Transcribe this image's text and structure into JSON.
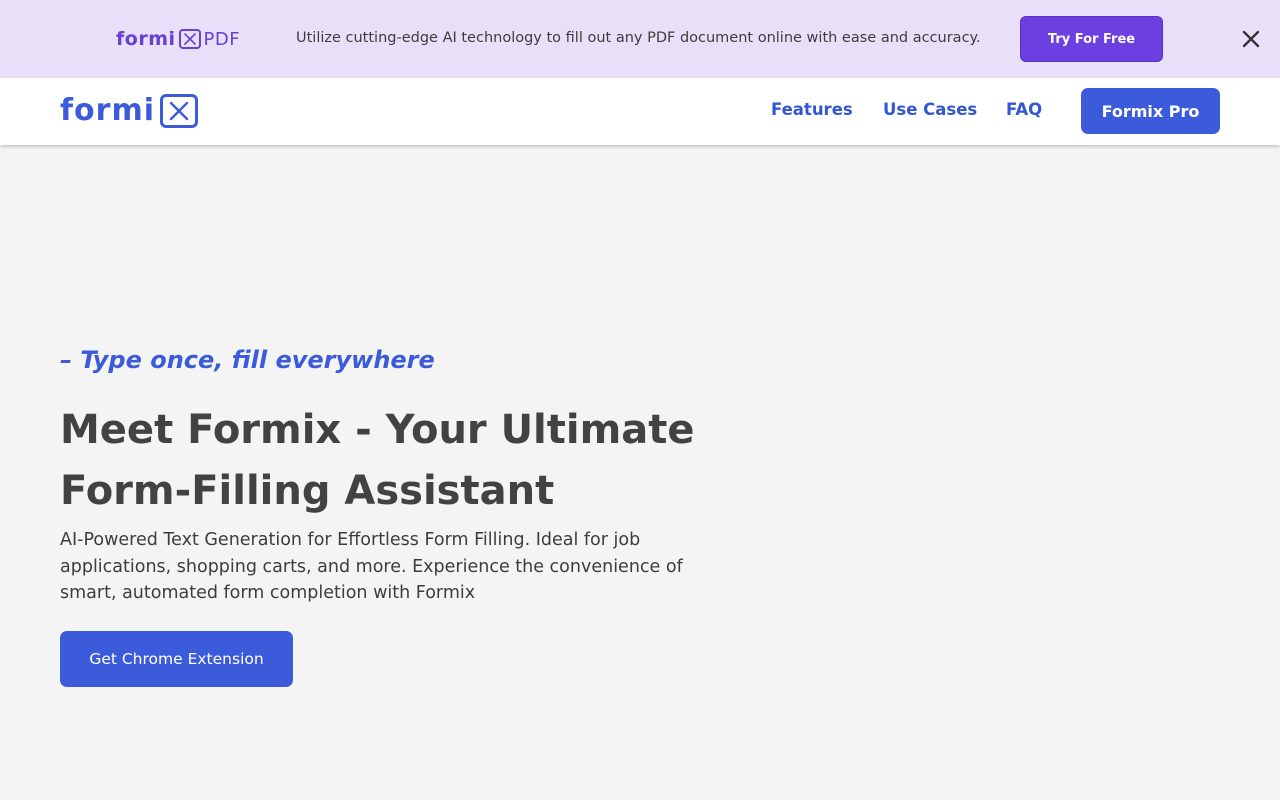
{
  "promo": {
    "brand_wordmark": "formi",
    "brand_suffix": "PDF",
    "message": "Utilize cutting-edge AI technology to fill out any PDF document online with ease and accuracy.",
    "cta_label": "Try For Free",
    "close_icon": "close-icon"
  },
  "header": {
    "brand_wordmark": "formi",
    "nav": [
      {
        "label": "Features"
      },
      {
        "label": "Use Cases"
      },
      {
        "label": "FAQ"
      }
    ],
    "pro_label": "Formix Pro"
  },
  "hero": {
    "tagline": "– Type once, fill everywhere",
    "headline": "Meet Formix - Your Ultimate Form-Filling Assistant",
    "subtext": "AI-Powered Text Generation for Effortless Form Filling. Ideal for job applications, shopping carts, and more. Experience the convenience of smart, automated form completion with Formix",
    "cta_label": "Get Chrome Extension"
  },
  "colors": {
    "brand_blue": "#3b5bdb",
    "promo_purple": "#6b3fe0",
    "promo_bg": "#e8e0f8",
    "page_bg": "#f4f4f5"
  }
}
